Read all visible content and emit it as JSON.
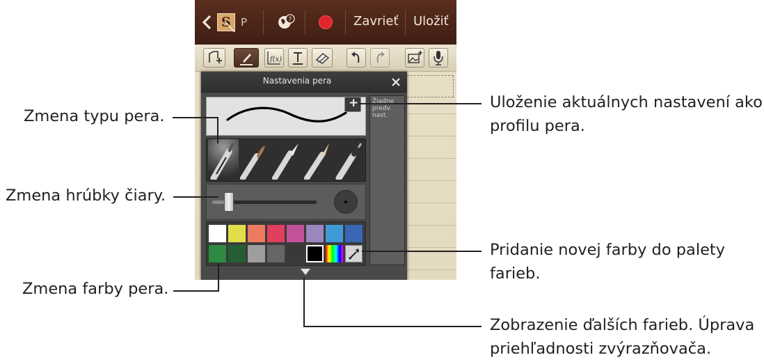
{
  "action_bar": {
    "back_icon": "chevron-left-icon",
    "s_pen_app_label": "S",
    "tab_label": "P",
    "zavriet": "Zavrieť",
    "ulozit": "Uložiť",
    "record_color": "#e0262a"
  },
  "toolbar": {
    "items": [
      "new-page-icon",
      "pen-icon",
      "formula-icon",
      "text-icon",
      "eraser-icon",
      "undo-icon",
      "redo-icon",
      "insert-image-icon",
      "microphone-icon"
    ]
  },
  "pen_settings": {
    "title": "Nastavenia pera",
    "close_icon": "close-icon",
    "add_preset": "+",
    "presets_text": "Žiadne\npredv.\nnast.",
    "selected_color": "#000000",
    "palette_row1": [
      "#ffffff",
      "#e2de4a",
      "#ec7a5e",
      "#e0405e",
      "#c2529a",
      "#9b86c0",
      "#3f9bd5",
      "#3a66b6"
    ],
    "palette_row2": [
      "#2e8a41",
      "#255e34",
      "#9e9e9e",
      "#666666",
      "#393939",
      "#000000"
    ]
  },
  "callouts": {
    "pen_type": "Zmena typu pera.",
    "line_thickness": "Zmena hrúbky čiary.",
    "pen_color": "Zmena farby pera.",
    "save_settings_line1": "Uloženie aktuálnych nastavení ako",
    "save_settings_line2": "profilu pera.",
    "add_color_line1": "Pridanie novej farby do palety",
    "add_color_line2": "farieb.",
    "more_colors_line1": "Zobrazenie ďalších farieb. Úprava",
    "more_colors_line2": "priehľadnosti zvýrazňovača."
  }
}
